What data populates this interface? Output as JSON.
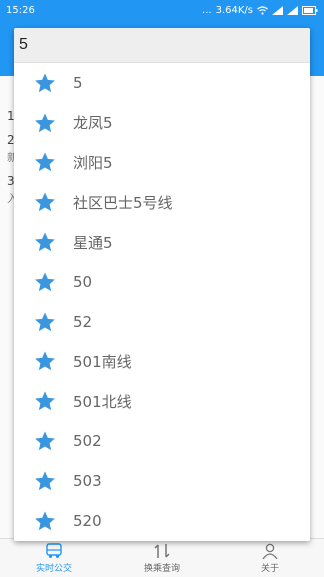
{
  "status_bar": {
    "time": "15:26",
    "dots": "...",
    "network_speed": "3.64K/s",
    "icons": [
      "wifi-icon",
      "signal-icon",
      "signal-icon",
      "battery-icon"
    ]
  },
  "search": {
    "value": "5",
    "placeholder": ""
  },
  "suggestions": [
    {
      "label": "5",
      "icon": "star-icon"
    },
    {
      "label": "龙凤5",
      "icon": "star-icon"
    },
    {
      "label": "浏阳5",
      "icon": "star-icon"
    },
    {
      "label": "社区巴士5号线",
      "icon": "star-icon"
    },
    {
      "label": "星通5",
      "icon": "star-icon"
    },
    {
      "label": "50",
      "icon": "star-icon"
    },
    {
      "label": "52",
      "icon": "star-icon"
    },
    {
      "label": "501南线",
      "icon": "star-icon"
    },
    {
      "label": "501北线",
      "icon": "star-icon"
    },
    {
      "label": "502",
      "icon": "star-icon"
    },
    {
      "label": "503",
      "icon": "star-icon"
    },
    {
      "label": "520",
      "icon": "star-icon"
    }
  ],
  "background_list": {
    "numbers": [
      "1",
      "2",
      "3"
    ],
    "fragments": [
      "新",
      "入"
    ]
  },
  "bottom_nav": {
    "items": [
      {
        "label": "实时公交",
        "icon": "bus-icon",
        "active": true
      },
      {
        "label": "换乘查询",
        "icon": "transfer-icon",
        "active": false
      },
      {
        "label": "关于",
        "icon": "person-icon",
        "active": false
      }
    ]
  },
  "colors": {
    "accent": "#2196F3",
    "star": "#3b96e0",
    "text": "#666666"
  }
}
